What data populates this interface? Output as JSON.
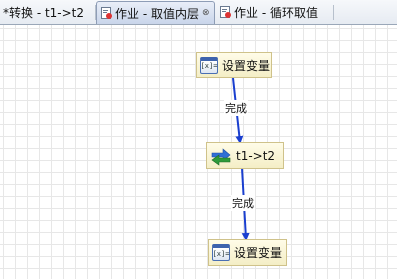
{
  "tabs": [
    {
      "label": "*转换 - t1->t2",
      "active": false,
      "closable": false
    },
    {
      "label": "作业 - 取值内层",
      "active": true,
      "closable": true
    },
    {
      "label": "作业 - 循环取值",
      "active": false,
      "closable": false
    }
  ],
  "steps": {
    "set_var_top": {
      "label": "设置变量",
      "icon": "set-variable-icon",
      "icon_text": "[x]="
    },
    "transform": {
      "label": "t1->t2",
      "icon": "transformation-icon"
    },
    "set_var_bottom": {
      "label": "设置变量",
      "icon": "set-variable-icon",
      "icon_text": "[x]="
    }
  },
  "hops": [
    {
      "label": "完成",
      "color": "#1a3fcf"
    },
    {
      "label": "完成",
      "color": "#1a3fcf"
    }
  ],
  "colors": {
    "hop_line": "#1a3fcf",
    "step_fill": "#fffce8",
    "transform_arrow_green": "#2e9a3a",
    "transform_arrow_blue": "#2f6fd6"
  }
}
